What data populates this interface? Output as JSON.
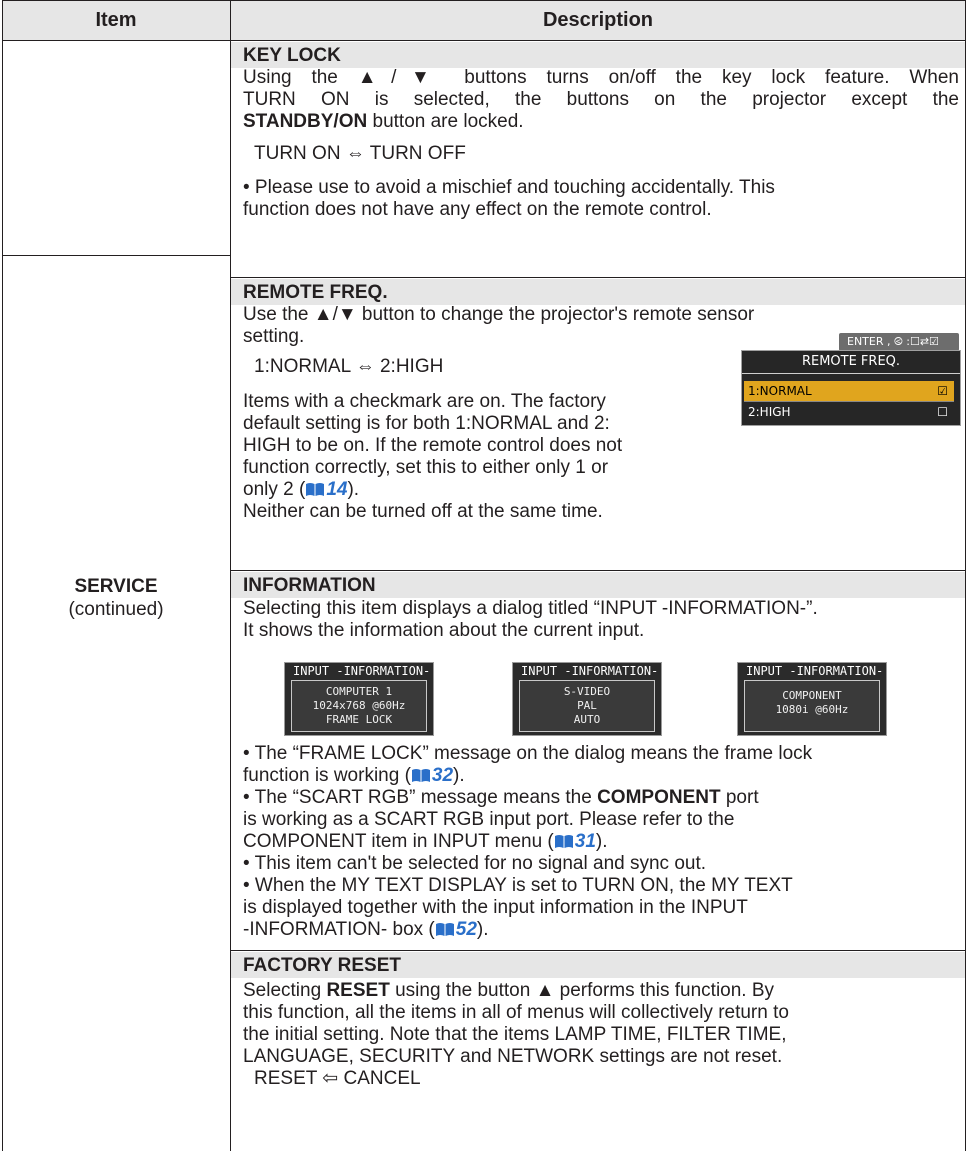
{
  "header": {
    "item": "Item",
    "description": "Description"
  },
  "service": {
    "name": "SERVICE",
    "continued": "(continued)"
  },
  "key_lock": {
    "title": "KEY LOCK",
    "lines": [
      "Using the ▲/▼ buttons turns on/off the key lock feature. When",
      "TURN ON is selected, the buttons on the projector except the"
    ],
    "line3_bold": "STANDBY/ON",
    "line3_rest": " button are locked.",
    "toggle": "TURN ON ⇔ TURN OFF",
    "note1": "• Please use to avoid a mischief and touching accidentally. This",
    "note2": "function does not have any effect on the remote control."
  },
  "remote_freq": {
    "title": "REMOTE FREQ.",
    "line1": "Use the ▲/▼ button to change the projector's remote sensor",
    "line2": "setting.",
    "toggle": "1:NORMAL ⇔ 2:HIGH",
    "p1": "Items with a checkmark are on. The factory",
    "p2": "default setting is for both 1:NORMAL and 2:",
    "p3": "HIGH to be on.  If the remote control does not",
    "p4": "function correctly, set this to either only 1 or",
    "p5_pre": "only 2 (",
    "p5_ref": "14",
    "p5_post": ").",
    "p6": "Neither can be turned off at the same time.",
    "menu": {
      "enter_hint": "ENTER , ⧀ :☐⇄☑",
      "title": "REMOTE FREQ.",
      "items": [
        {
          "label": "1:NORMAL",
          "check": "☑"
        },
        {
          "label": "2:HIGH",
          "check": "☐"
        }
      ]
    }
  },
  "information": {
    "title": "INFORMATION",
    "line1": "Selecting this item displays a dialog titled “INPUT -INFORMATION-”.",
    "line2": "It shows the information about the current input.",
    "dialogs": [
      {
        "title": "INPUT -INFORMATION-",
        "lines": [
          "COMPUTER 1",
          "1024x768 @60Hz",
          "FRAME LOCK"
        ]
      },
      {
        "title": "INPUT -INFORMATION-",
        "lines": [
          "S-VIDEO",
          "PAL",
          "AUTO"
        ]
      },
      {
        "title": "INPUT -INFORMATION-",
        "lines": [
          "COMPONENT",
          "1080i @60Hz"
        ]
      }
    ],
    "b1_l1": "• The “FRAME LOCK” message on the dialog means the frame lock",
    "b1_l2_pre": "function is working (",
    "b1_ref": "32",
    "b1_l2_post": ").",
    "b2_l1_pre": "• The “SCART RGB” message means the ",
    "b2_l1_bold": "COMPONENT",
    "b2_l1_post": " port",
    "b2_l2": "is working as a SCART RGB input port. Please refer to the",
    "b2_l3_pre": "COMPONENT item in INPUT menu (",
    "b2_ref": "31",
    "b2_l3_post": ").",
    "b3": "• This item can't be selected for no signal and sync out.",
    "b4_l1": "• When the MY TEXT DISPLAY is set to TURN ON, the MY TEXT",
    "b4_l2": "is displayed together with the input information in the INPUT",
    "b4_l3_pre": "-INFORMATION- box (",
    "b4_ref": "52",
    "b4_l3_post": ")."
  },
  "factory_reset": {
    "title": "FACTORY RESET",
    "l1_pre": "Selecting ",
    "l1_bold": "RESET",
    "l1_post": " using the button ▲ performs this function. By",
    "l2": "this function, all the items in all of menus will collectively return to",
    "l3": "the initial setting. Note that the items LAMP TIME, FILTER TIME,",
    "l4": "LANGUAGE, SECURITY and NETWORK settings are not reset.",
    "toggle": "RESET ⇦ CANCEL"
  }
}
